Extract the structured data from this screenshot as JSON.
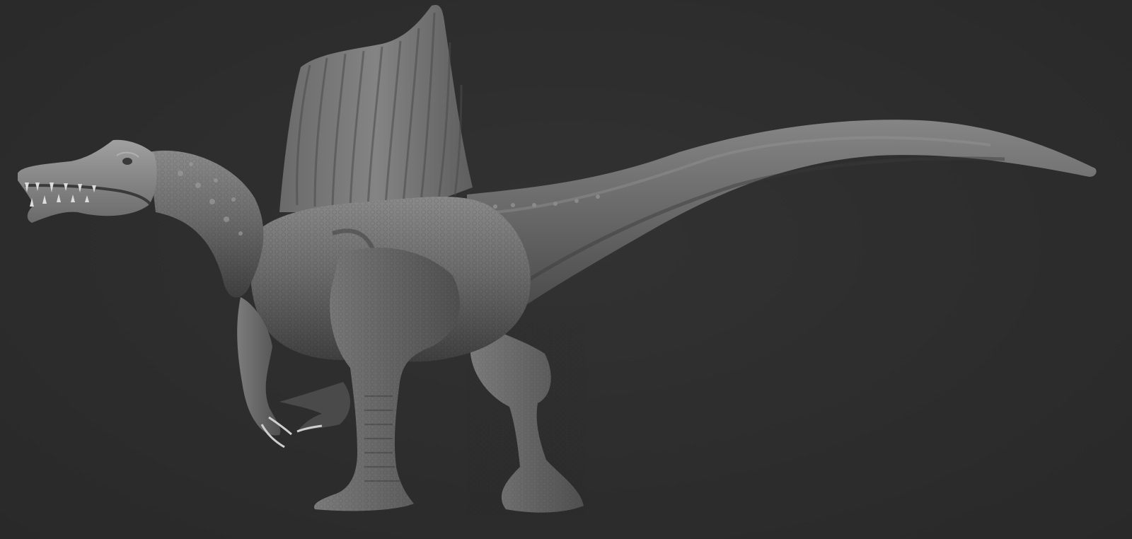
{
  "scene": {
    "subject": "spinosaurus-sculpt",
    "background_color": "#2d2d2d",
    "clay_color": "#6e6e6e",
    "clay_highlight": "#9a9a9a",
    "clay_shadow": "#3e3e3e"
  }
}
